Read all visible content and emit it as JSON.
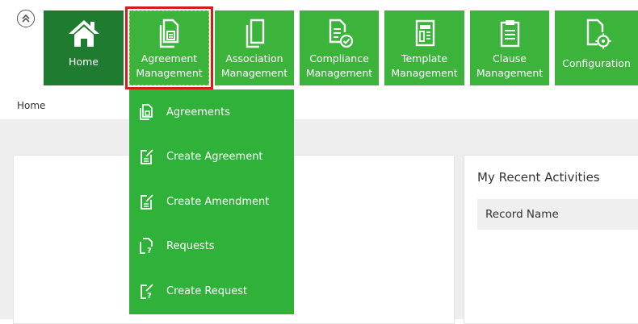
{
  "nav": {
    "collapse_icon": "double-chevron-up-icon",
    "tiles": [
      {
        "label": "Home",
        "icon": "home-icon"
      },
      {
        "label": "Agreement\nManagement",
        "icon": "agreement-icon"
      },
      {
        "label": "Association\nManagement",
        "icon": "documents-icon"
      },
      {
        "label": "Compliance\nManagement",
        "icon": "compliance-check-icon"
      },
      {
        "label": "Template\nManagement",
        "icon": "template-icon"
      },
      {
        "label": "Clause\nManagement",
        "icon": "clipboard-icon"
      },
      {
        "label": "Configuration",
        "icon": "document-gear-icon"
      }
    ],
    "colors": {
      "tile": "#3cb43c",
      "home_tile": "#1e7b30",
      "active_outline": "#d41c1c"
    }
  },
  "breadcrumb": "Home",
  "dropdown": {
    "items": [
      {
        "label": "Agreements",
        "icon": "agreements-icon"
      },
      {
        "label": "Create Agreement",
        "icon": "create-document-icon"
      },
      {
        "label": "Create Amendment",
        "icon": "create-amendment-icon"
      },
      {
        "label": "Requests",
        "icon": "requests-icon"
      },
      {
        "label": "Create Request",
        "icon": "create-request-icon"
      }
    ]
  },
  "recent_activities": {
    "title": "My Recent Activities",
    "column_header": "Record Name"
  }
}
